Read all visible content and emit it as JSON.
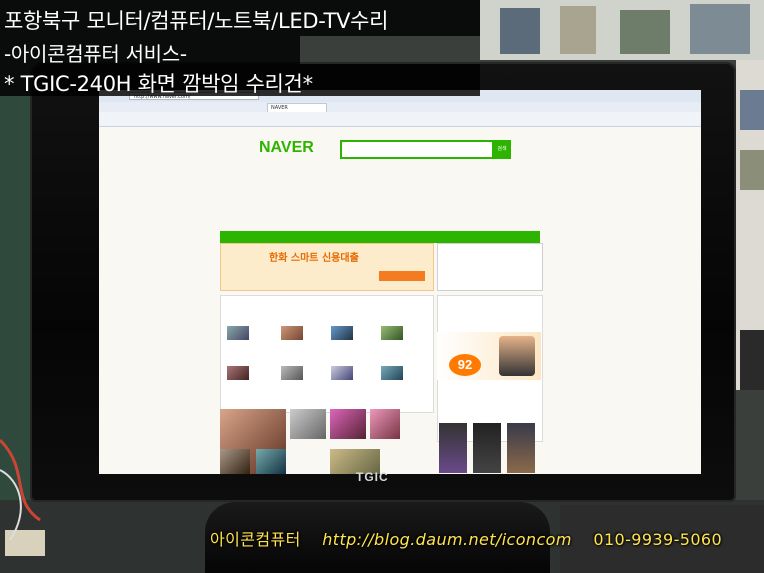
{
  "title": {
    "line1": "포항북구 모니터/컴퓨터/노트북/LED-TV수리",
    "line2": "-아이콘컴퓨터 서비스-",
    "line3": "* TGIC-240H 화면 깜박임 수리건*"
  },
  "monitor": {
    "brand": "TGIC"
  },
  "browser": {
    "address": "http://www.naver.com/",
    "tabs": [
      "NAVER"
    ],
    "logo": "NAVER",
    "search_button": "검색",
    "ad_title": "한화 스마트 신용대출",
    "ad_big": "92"
  },
  "footer": {
    "shop": "아이콘컴퓨터",
    "url": "http://blog.daum.net/iconcom",
    "phone": "010-9939-5060"
  }
}
